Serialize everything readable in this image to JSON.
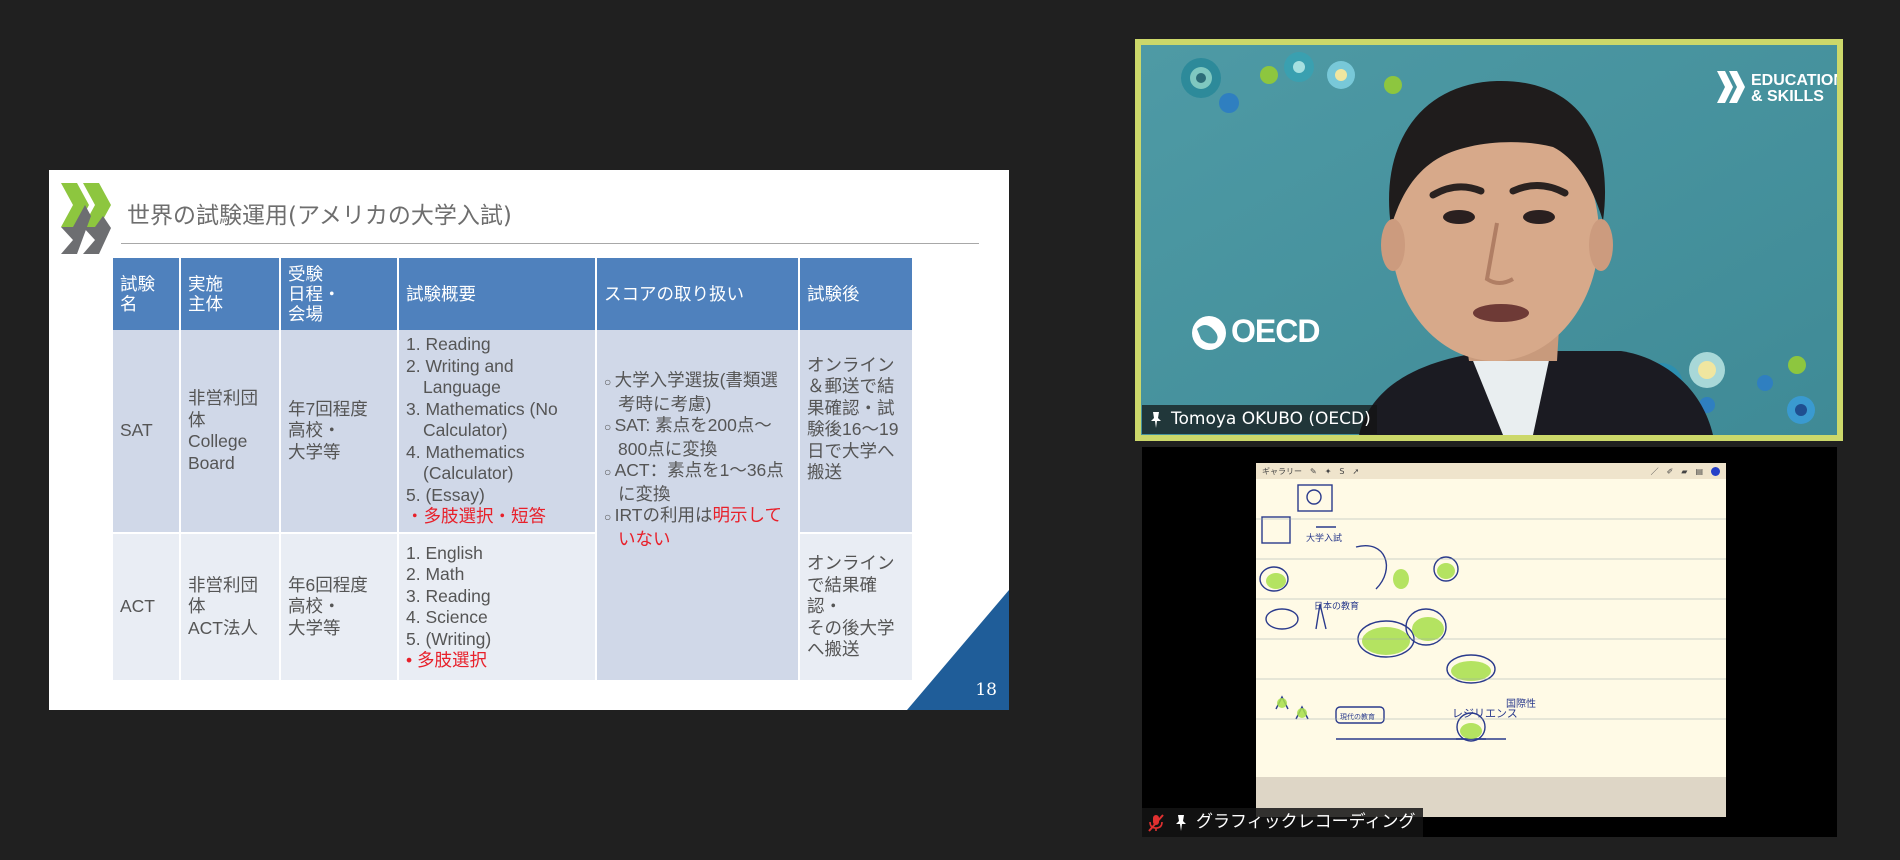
{
  "slide": {
    "title": "世界の試験運用(アメリカの大学入試)",
    "page_number": "18",
    "logo_colors": [
      "#8dc63f",
      "#6d6e71"
    ],
    "accent_color": "#1f5d99",
    "table": {
      "headers": [
        "試験名",
        "実施主体",
        "受験日程・会場",
        "試験概要",
        "スコアの取り扱い",
        "試験後"
      ],
      "header_lines": {
        "exam": [
          "試験",
          "名"
        ],
        "org": [
          "実施",
          "主体"
        ],
        "schedule": [
          "受験",
          "日程・",
          "会場"
        ]
      },
      "rows": [
        {
          "name": "SAT",
          "org_lines": [
            "非営利団",
            "体",
            "College",
            "Board"
          ],
          "schedule_lines": [
            "年7回程度",
            "高校・",
            "大学等"
          ],
          "overview": [
            "1. Reading",
            "2. Writing and Language",
            "3. Mathematics (No Calculator)",
            "4. Mathematics (Calculator)",
            "5. (Essay)"
          ],
          "overview_note": "・多肢選択・短答",
          "after_lines": [
            "オンライン",
            "＆郵送で結",
            "果確認・試",
            "験後16～19",
            "日で大学へ",
            "搬送"
          ]
        },
        {
          "name": "ACT",
          "org_lines": [
            "非営利団",
            "体",
            "ACT法人"
          ],
          "schedule_lines": [
            "年6回程度",
            "高校・",
            "大学等"
          ],
          "overview": [
            "1. English",
            "2. Math",
            "3. Reading",
            "4. Science",
            "5. (Writing)"
          ],
          "overview_note": "• 多肢選択",
          "after_lines": [
            "オンライン",
            "で結果確認・",
            "その後大学",
            "へ搬送"
          ]
        }
      ],
      "score": {
        "items": [
          "大学入学選抜(書類選考時に考慮)",
          "SAT: 素点を200点～800点に変換",
          "ACT：素点を1～36点に変換"
        ],
        "irt_prefix": "IRTの利用は",
        "irt_highlight": "明示していない"
      }
    }
  },
  "speaker": {
    "name": "Tomoya OKUBO (OECD)",
    "brand_line1": "EDUCATION",
    "brand_line2": "& SKILLS",
    "oecd": "OECD",
    "border_color": "#ccd86a"
  },
  "graphic": {
    "name": "グラフィックレコーディング",
    "toolbar_gallery": "ギャラリー",
    "sketch_words": [
      "日本の教育",
      "レジリエンス",
      "国際性",
      "大学入試",
      "現代の教育"
    ]
  }
}
